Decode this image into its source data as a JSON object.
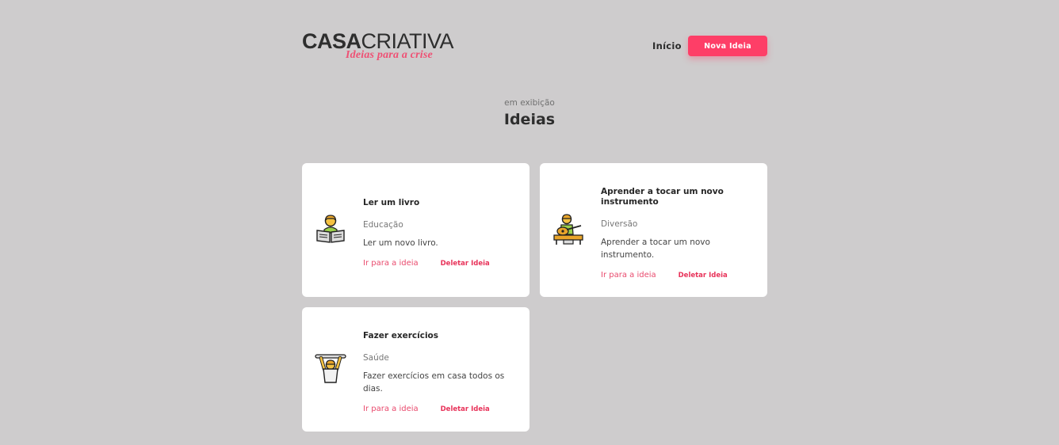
{
  "header": {
    "logo_strong": "CASA",
    "logo_light": "CRIATIVA",
    "logo_tagline": "Ideias para a crise",
    "nav_home": "Início",
    "nav_new": "Nova Ideia"
  },
  "section": {
    "kicker": "em exibição",
    "title": "Ideias"
  },
  "ideas": [
    {
      "title": "Ler um livro",
      "category": "Educação",
      "description": "Ler um novo livro.",
      "link_label": "Ir para a ideia",
      "delete_label": "Deletar Ideia",
      "icon": "reading-person-icon"
    },
    {
      "title": "Aprender a tocar um novo instrumento",
      "category": "Diversão",
      "description": "Aprender a tocar um novo instrumento.",
      "link_label": "Ir para a ideia",
      "delete_label": "Deletar Ideia",
      "icon": "guitar-player-icon"
    },
    {
      "title": "Fazer exercícios",
      "category": "Saúde",
      "description": "Fazer exercícios em casa todos os dias.",
      "link_label": "Ir para a ideia",
      "delete_label": "Deletar Ideia",
      "icon": "pull-up-exercise-icon"
    }
  ],
  "colors": {
    "background": "#cecccd",
    "accent": "#fe3e67",
    "card": "#ffffff"
  }
}
